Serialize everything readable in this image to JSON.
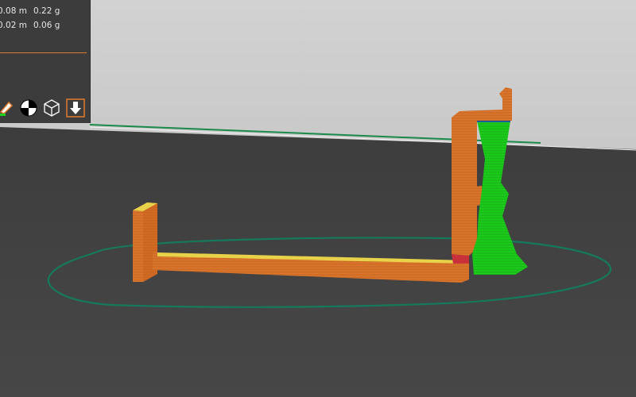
{
  "stats": {
    "rows": [
      {
        "length": "0.08 m",
        "weight": "0.22 g"
      },
      {
        "length": "0.02 m",
        "weight": "0.06 g"
      }
    ]
  },
  "toolbar": {
    "buttons": [
      {
        "icon": "brush-edit-icon"
      },
      {
        "icon": "pivot-target-icon"
      },
      {
        "icon": "wireframe-cube-icon"
      },
      {
        "icon": "download-arrow-icon"
      }
    ]
  },
  "colors": {
    "background_top": "#c8c8c8",
    "floor": "#3a3a3a",
    "print_orange": "#e07a2e",
    "print_green": "#1ed21e",
    "skirt": "#1a8a6a",
    "panel": "#3c3c3c",
    "accent": "#e07a2e"
  }
}
